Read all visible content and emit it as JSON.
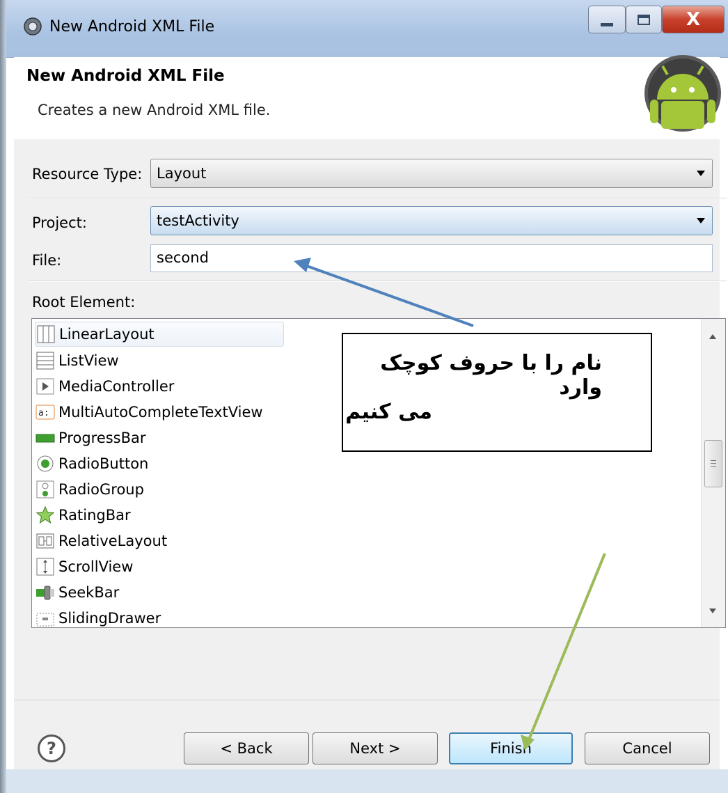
{
  "window": {
    "title": "New Android XML File",
    "controls": {
      "minimize": "minimize",
      "maximize": "maximize",
      "close": "X"
    }
  },
  "header": {
    "title": "New Android XML File",
    "subtitle": "Creates a new Android XML file."
  },
  "form": {
    "resource_type": {
      "label": "Resource Type:",
      "value": "Layout"
    },
    "project": {
      "label": "Project:",
      "value": "testActivity"
    },
    "file": {
      "label": "File:",
      "value": "second"
    },
    "root_element_label": "Root Element:"
  },
  "root_elements": [
    {
      "label": "LinearLayout",
      "icon": "linear-layout-icon",
      "selected": true
    },
    {
      "label": "ListView",
      "icon": "list-view-icon"
    },
    {
      "label": "MediaController",
      "icon": "media-controller-icon"
    },
    {
      "label": "MultiAutoCompleteTextView",
      "icon": "autocomplete-icon"
    },
    {
      "label": "ProgressBar",
      "icon": "progress-bar-icon"
    },
    {
      "label": "RadioButton",
      "icon": "radio-button-icon"
    },
    {
      "label": "RadioGroup",
      "icon": "radio-group-icon"
    },
    {
      "label": "RatingBar",
      "icon": "rating-bar-icon"
    },
    {
      "label": "RelativeLayout",
      "icon": "relative-layout-icon"
    },
    {
      "label": "ScrollView",
      "icon": "scroll-view-icon"
    },
    {
      "label": "SeekBar",
      "icon": "seek-bar-icon"
    },
    {
      "label": "SlidingDrawer",
      "icon": "sliding-drawer-icon"
    }
  ],
  "annotation": {
    "line1": "نام را با حروف کوچک وارد",
    "line2": "می کنیم",
    "arrow_colors": {
      "blue": "#4f81bd",
      "green": "#9bbb59"
    }
  },
  "buttons": {
    "help": "?",
    "back": "< Back",
    "next": "Next >",
    "finish": "Finish",
    "cancel": "Cancel"
  }
}
